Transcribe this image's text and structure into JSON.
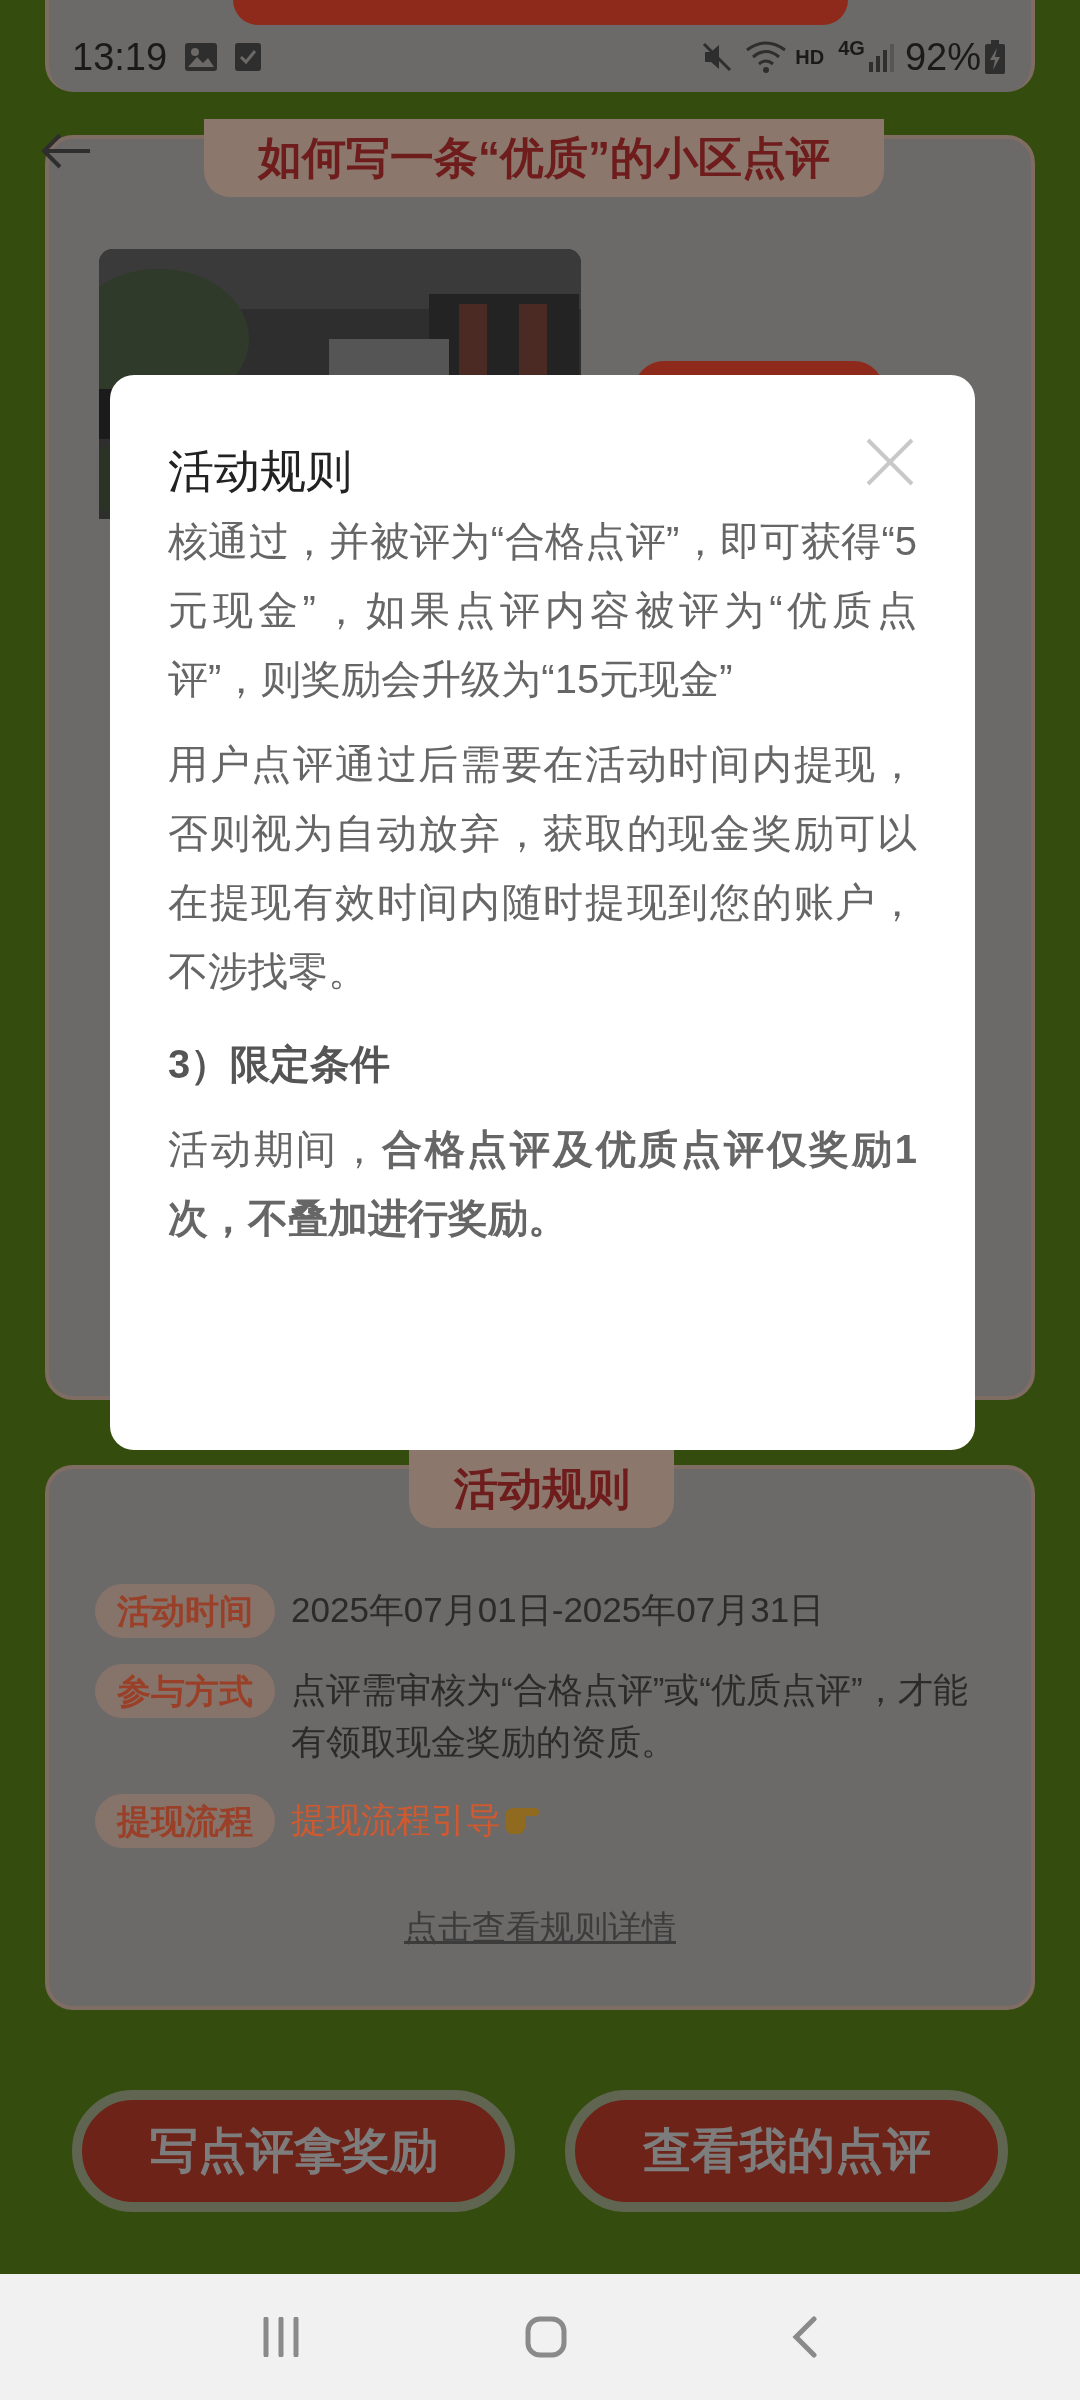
{
  "status_bar": {
    "time": "13:19",
    "network_hd": "HD",
    "network_type": "4G",
    "battery": "92%"
  },
  "guide_card": {
    "title": "如何写一条“优质”的小区点评"
  },
  "rules_dialog": {
    "title": "活动规则",
    "paragraphs": [
      {
        "kind": "text",
        "text": "核通过，并被评为“合格点评”，即可获得“5元现金”，如果点评内容被评为“优质点评”，则奖励会升级为“15元现金”"
      },
      {
        "kind": "text",
        "text": "用户点评通过后需要在活动时间内提现，否则视为自动放弃，获取的现金奖励可以在提现有效时间内随时提现到您的账户，不涉找零。"
      },
      {
        "kind": "heading",
        "text": "3）限定条件"
      },
      {
        "kind": "text",
        "text": "活动期间，**合格点评及优质点评仅奖励1次，不叠加进行奖励。**"
      }
    ]
  },
  "rules_card": {
    "title": "活动规则",
    "rows": [
      {
        "kind": "text",
        "tag": "活动时间",
        "text": "2025年07月01日-2025年07月31日"
      },
      {
        "kind": "text",
        "tag": "参与方式",
        "text": "点评需审核为“合格点评”或“优质点评”，才能有领取现金奖励的资质。"
      },
      {
        "kind": "link",
        "tag": "提现流程",
        "text": "提现流程引导"
      }
    ],
    "details_link": "点击查看规则详情"
  },
  "buttons": [
    "写点评拿奖励",
    "查看我的点评"
  ]
}
